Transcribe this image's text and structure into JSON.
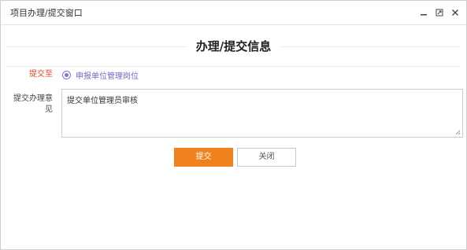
{
  "window": {
    "title": "项目办理/提交窗口"
  },
  "heading": "办理/提交信息",
  "form": {
    "submit_to_label": "提交至",
    "submit_to_option": "申报单位管理岗位",
    "opinion_label": "提交办理意见",
    "opinion_value": "提交单位管理员审核"
  },
  "buttons": {
    "submit": "提交",
    "close": "关闭"
  },
  "colors": {
    "accent": "#f0821e",
    "radio": "#8b6fd9",
    "required_label": "#e04a2e"
  },
  "icons": {
    "minimize": "minimize-icon",
    "maximize": "maximize-icon",
    "close": "close-icon"
  }
}
